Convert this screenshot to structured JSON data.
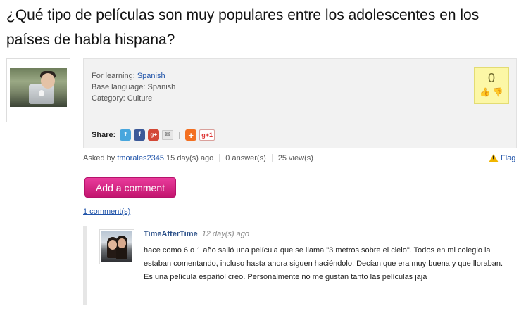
{
  "question": {
    "title": "¿Qué tipo de películas son muy populares entre los adolescentes en los países de habla hispana?"
  },
  "info": {
    "learning_label": "For learning:",
    "learning_value": "Spanish",
    "base_label": "Base language:",
    "base_value": "Spanish",
    "category_label": "Category:",
    "category_value": "Culture",
    "votes": "0",
    "share_label": "Share:",
    "share_icons": [
      "twitter-icon",
      "facebook-icon",
      "google-plus-icon",
      "email-icon",
      "add-icon",
      "google-plus-one-icon"
    ],
    "gplus_text": "g+",
    "gplusone_text": "g+1",
    "add_text": "+"
  },
  "stats": {
    "asked_by_label": "Asked by",
    "author": "tmorales2345",
    "age": "15 day(s) ago",
    "answers": "0 answer(s)",
    "views": "25 view(s)",
    "flag": "Flag"
  },
  "actions": {
    "add_comment": "Add a comment",
    "comment_count": "1 comment(s)"
  },
  "comment": {
    "author": "TimeAfterTime",
    "time": "12 day(s) ago",
    "text": "hace como 6 o 1 año salió una película que se llama \"3 metros sobre el cielo\". Todos en mi colegio la estaban comentando, incluso hasta ahora siguen haciéndolo. Decían que era muy buena y que lloraban. Es una película español creo. Personalmente no me gustan tanto las películas jaja"
  },
  "colors": {
    "accent": "#d4237f",
    "link": "#2255aa",
    "vote_bg": "#fcf7a6"
  }
}
